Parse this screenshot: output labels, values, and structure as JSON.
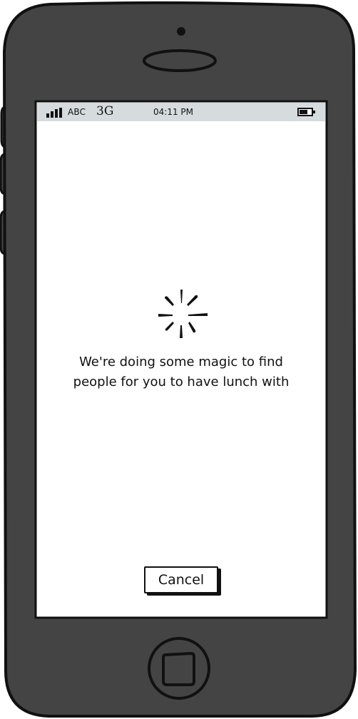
{
  "status_bar": {
    "carrier": "ABC",
    "network": "3G",
    "time": "04:11 PM",
    "signal_icon": "signal-bars-icon",
    "battery_icon": "battery-icon"
  },
  "loading": {
    "spinner_icon": "loading-spinner-icon",
    "message_line1": "We're doing some magic to find",
    "message_line2": "people for you to have lunch with"
  },
  "actions": {
    "cancel_label": "Cancel"
  },
  "colors": {
    "phone_body": "#444444",
    "phone_outline": "#111111",
    "status_bar": "#d6dbde",
    "screen": "#ffffff"
  }
}
